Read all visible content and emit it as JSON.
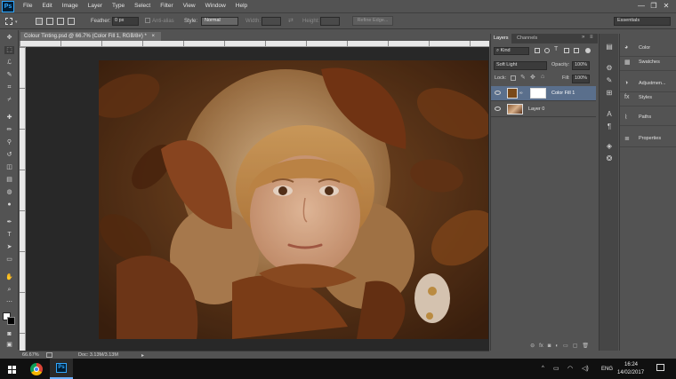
{
  "app": {
    "logo": "Ps",
    "menu": [
      "File",
      "Edit",
      "Image",
      "Layer",
      "Type",
      "Select",
      "Filter",
      "View",
      "Window",
      "Help"
    ],
    "window_controls": [
      "—",
      "❐",
      "✕"
    ]
  },
  "options_bar": {
    "feather_label": "Feather:",
    "feather_value": "0 px",
    "antialias_label": "Anti-alias",
    "style_label": "Style:",
    "style_value": "Normal",
    "width_label": "Width:",
    "height_label": "Height:",
    "refine_edge": "Refine Edge...",
    "workspace": "Essentials"
  },
  "document": {
    "tab_title": "Colour Tinting.psd @ 66.7% (Color Fill 1, RGB/8#) *",
    "tab_close": "×",
    "zoom": "66.67%",
    "doc_size": "Doc: 3.13M/3.13M"
  },
  "layers_panel": {
    "tabs": [
      "Layers",
      "Channels"
    ],
    "kind": "Kind",
    "blend_mode": "Soft Light",
    "opacity_label": "Opacity:",
    "opacity_value": "100%",
    "lock_label": "Lock:",
    "fill_label": "Fill:",
    "fill_value": "100%",
    "layers": [
      {
        "name": "Color Fill 1",
        "selected": true,
        "swatch": "#7a4a1a"
      },
      {
        "name": "Layer 0",
        "selected": false
      }
    ],
    "footer_icons": [
      "link-icon",
      "fx-icon",
      "mask-icon",
      "adjustment-icon",
      "folder-icon",
      "new-layer-icon",
      "trash-icon"
    ]
  },
  "right_panels": {
    "items": [
      {
        "label": "Color",
        "icon": "color-icon"
      },
      {
        "label": "Swatches",
        "icon": "swatches-icon"
      },
      {
        "label": "Adjustmen...",
        "icon": "adjustments-icon"
      },
      {
        "label": "Styles",
        "icon": "styles-icon"
      },
      {
        "label": "Paths",
        "icon": "paths-icon"
      },
      {
        "label": "Properties",
        "icon": "properties-icon"
      }
    ]
  },
  "taskbar": {
    "language": "ENG",
    "time": "16:24",
    "date": "14/02/2017"
  },
  "colors": {
    "accent": "#31a8ff",
    "panel_bg": "#535353",
    "canvas_bg": "#282828",
    "selected_layer": "#5a6f8c"
  }
}
